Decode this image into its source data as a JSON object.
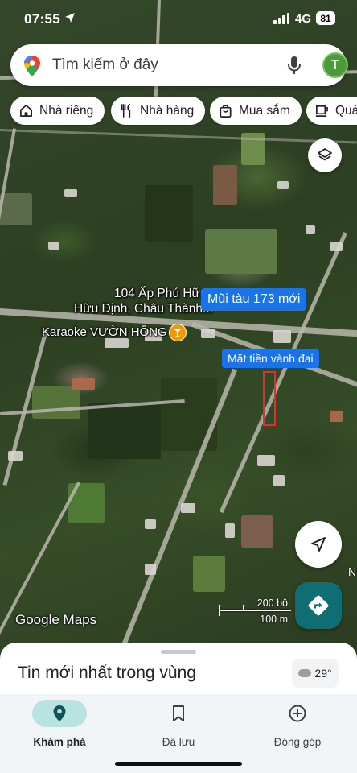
{
  "status_bar": {
    "time": "07:55",
    "network": "4G",
    "battery": "81"
  },
  "search": {
    "placeholder": "Tìm kiếm ở đây",
    "avatar_letter": "T"
  },
  "chips": [
    {
      "label": "Nhà riêng",
      "icon": "home-icon"
    },
    {
      "label": "Nhà hàng",
      "icon": "restaurant-icon"
    },
    {
      "label": "Mua sắm",
      "icon": "shopping-bag-icon"
    },
    {
      "label": "Quá",
      "icon": "coffee-icon"
    }
  ],
  "map": {
    "address_line1": "104 Ấp Phú Hữu,",
    "address_line2": "Hữu Định, Châu Thành...",
    "poi_label": "Karaoke VƯỜN HỒNG",
    "tag_1": "Mũi tàu 173 mới",
    "tag_2": "Mặt tiền vành đai",
    "edge_letter": "N",
    "logo": "Google Maps",
    "scale_top": "200 bộ",
    "scale_bottom": "100 m"
  },
  "sheet": {
    "title": "Tin mới nhất trong vùng",
    "temperature": "29°"
  },
  "nav": {
    "items": [
      {
        "label": "Khám phá",
        "icon": "explore-pin-icon",
        "active": true
      },
      {
        "label": "Đã lưu",
        "icon": "bookmark-icon",
        "active": false
      },
      {
        "label": "Đóng góp",
        "icon": "add-circle-icon",
        "active": false
      }
    ]
  },
  "colors": {
    "accent_blue": "#1a73e8",
    "directions_teal": "#0f6e74",
    "nav_active": "#b8e3e0",
    "plot_outline": "#e0302c"
  }
}
